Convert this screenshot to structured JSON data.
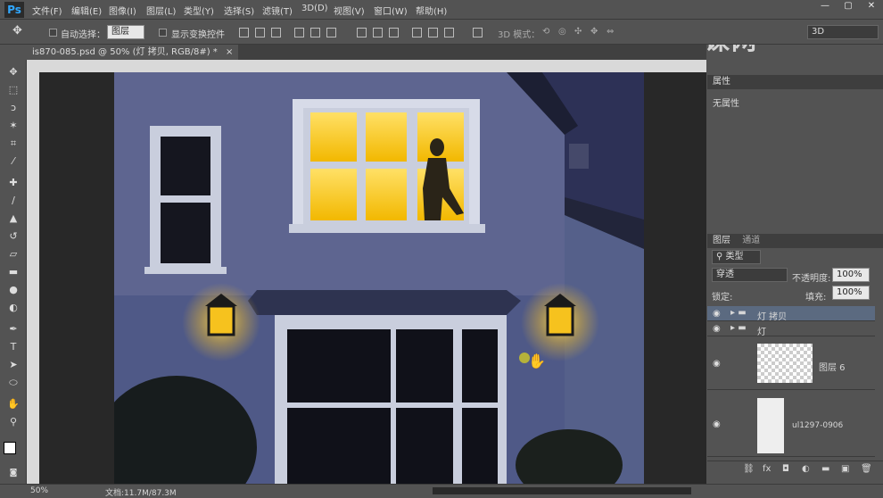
{
  "app": {
    "logo": "Ps",
    "watermark": "虎课网"
  },
  "menu": [
    "文件(F)",
    "编辑(E)",
    "图像(I)",
    "图层(L)",
    "类型(Y)",
    "选择(S)",
    "滤镜(T)",
    "3D(D)",
    "视图(V)",
    "窗口(W)",
    "帮助(H)"
  ],
  "options": {
    "auto_select_label": "自动选择：",
    "auto_select_value": "图层",
    "show_transform_label": "显示变换控件",
    "mode_3d_label": "3D 模式：",
    "workspace_value": "3D"
  },
  "document": {
    "tab_title": "is870-085.psd @ 50% (灯 拷贝, RGB/8#) *",
    "close": "×"
  },
  "status": {
    "zoom": "50%",
    "doc_info": "文档:11.7M/87.3M"
  },
  "properties": {
    "tab": "属性",
    "content": "无属性"
  },
  "layers_panel": {
    "tabs": [
      "图层",
      "通道"
    ],
    "filter_kind": "类型",
    "blend_mode": "穿透",
    "opacity_label": "不透明度:",
    "opacity_value": "100%",
    "lock_label": "锁定:",
    "fill_label": "填充:",
    "fill_value": "100%",
    "layers": [
      {
        "name": "灯 拷贝",
        "type": "group",
        "selected": true
      },
      {
        "name": "灯",
        "type": "group",
        "selected": false
      },
      {
        "name": "图层 6",
        "type": "pixel",
        "selected": false
      },
      {
        "name": "ul1297-0906",
        "type": "smart",
        "selected": false
      }
    ],
    "footer_icons": [
      "link-icon",
      "fx-icon",
      "mask-icon",
      "adjustment-icon",
      "folder-icon",
      "new-layer-icon",
      "trash-icon"
    ]
  },
  "tools": [
    "move-tool",
    "marquee-tool",
    "lasso-tool",
    "magic-wand-tool",
    "crop-tool",
    "eyedropper-tool",
    "healing-tool",
    "brush-tool",
    "stamp-tool",
    "history-brush-tool",
    "eraser-tool",
    "gradient-tool",
    "blur-tool",
    "dodge-tool",
    "pen-tool",
    "type-tool",
    "path-select-tool",
    "shape-tool",
    "hand-tool",
    "zoom-tool"
  ],
  "colors": {
    "ui": "#535353",
    "panel_dark": "#3e3e3e",
    "selected_layer": "#5b6a80",
    "window_light": "#f6c21e",
    "night_sky": "#2a2f52"
  }
}
